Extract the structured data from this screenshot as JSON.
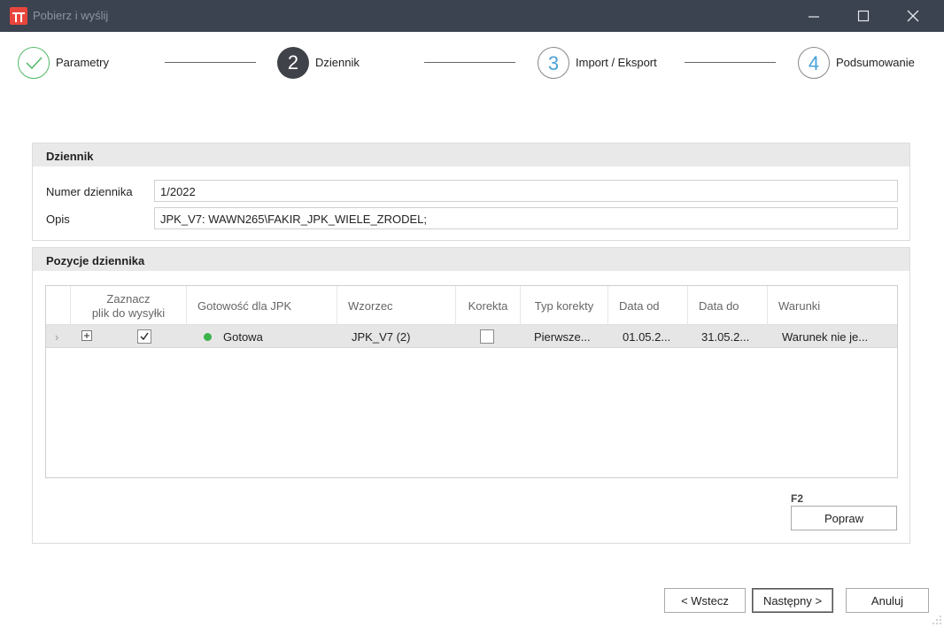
{
  "window": {
    "title": "Pobierz i wyślij"
  },
  "wizard": {
    "steps": [
      {
        "number": "",
        "label": "Parametry",
        "state": "done"
      },
      {
        "number": "2",
        "label": "Dziennik",
        "state": "active"
      },
      {
        "number": "3",
        "label": "Import / Eksport",
        "state": "todo"
      },
      {
        "number": "4",
        "label": "Podsumowanie",
        "state": "todo"
      }
    ]
  },
  "dziennik": {
    "header": "Dziennik",
    "numer_label": "Numer dziennika",
    "numer_value": "1/2022",
    "opis_label": "Opis",
    "opis_value": "JPK_V7: WAWN265\\FAKIR_JPK_WIELE_ZRODEL;"
  },
  "pozycje": {
    "header": "Pozycje dziennika",
    "columns": {
      "zaznacz_line1": "Zaznacz",
      "zaznacz_line2": "plik do wysyłki",
      "gotowosc": "Gotowość dla JPK",
      "wzorzec": "Wzorzec",
      "korekta": "Korekta",
      "typ_korekty": "Typ korekty",
      "data_od": "Data od",
      "data_do": "Data do",
      "warunki": "Warunki"
    },
    "rows": [
      {
        "selected": true,
        "gotowosc": "Gotowa",
        "status_color": "#3cb34a",
        "wzorzec": "JPK_V7 (2)",
        "korekta": false,
        "typ_korekty": "Pierwsze...",
        "data_od": "01.05.2...",
        "data_do": "31.05.2...",
        "warunki": "Warunek nie je..."
      }
    ],
    "shortcut": "F2",
    "popraw_label": "Popraw"
  },
  "footer": {
    "back_label": "< Wstecz",
    "next_label": "Następny >",
    "cancel_label": "Anuluj"
  },
  "colors": {
    "titlebar": "#3b4250",
    "step_done": "#52b867",
    "step_active": "#3f4248",
    "step_todo_number": "#4aa1d8"
  }
}
